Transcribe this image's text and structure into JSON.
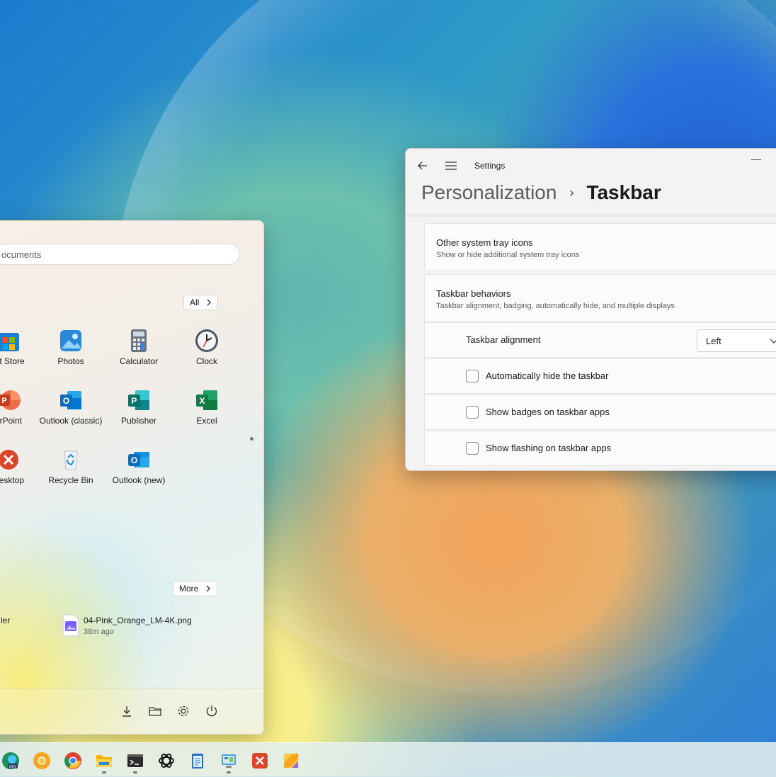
{
  "start_menu": {
    "search_placeholder": "ocuments",
    "pinned_all_label": "All",
    "pinned_apps": [
      {
        "label": "oft Store",
        "icon": "microsoft-store-icon"
      },
      {
        "label": "Photos",
        "icon": "photos-icon"
      },
      {
        "label": "Calculator",
        "icon": "calculator-icon"
      },
      {
        "label": "Clock",
        "icon": "clock-icon"
      },
      {
        "label": "erPoint",
        "icon": "powerpoint-icon"
      },
      {
        "label": "Outlook (classic)",
        "icon": "outlook-classic-icon"
      },
      {
        "label": "Publisher",
        "icon": "publisher-icon"
      },
      {
        "label": "Excel",
        "icon": "excel-icon"
      },
      {
        "label": "Desktop",
        "icon": "remote-desktop-icon"
      },
      {
        "label": "Recycle Bin",
        "icon": "recycle-bin-icon"
      },
      {
        "label": "Outlook (new)",
        "icon": "outlook-new-icon"
      }
    ],
    "recommended_more_label": "More",
    "recommended": [
      {
        "title": "ler",
        "subtitle": ""
      },
      {
        "title": "04-Pink_Orange_LM-4K.png",
        "subtitle": "38m ago"
      }
    ],
    "footer_icons": [
      "downloads-icon",
      "file-explorer-icon",
      "settings-icon",
      "power-icon"
    ]
  },
  "settings": {
    "window_title": "Settings",
    "breadcrumb_parent": "Personalization",
    "breadcrumb_separator": "›",
    "breadcrumb_current": "Taskbar",
    "other_tray": {
      "title": "Other system tray icons",
      "subtitle": "Show or hide additional system tray icons"
    },
    "behaviors": {
      "title": "Taskbar behaviors",
      "subtitle": "Taskbar alignment, badging, automatically hide, and multiple displays",
      "alignment_label": "Taskbar alignment",
      "alignment_value": "Left",
      "options": [
        {
          "label": "Automatically hide the taskbar",
          "checked": false
        },
        {
          "label": "Show badges on taskbar apps",
          "checked": false
        },
        {
          "label": "Show flashing on taskbar apps",
          "checked": false
        }
      ]
    }
  },
  "taskbar": {
    "apps": [
      "edge-dev-icon",
      "chrome-canary-icon",
      "chrome-icon",
      "file-explorer-icon",
      "terminal-icon",
      "chatgpt-icon",
      "notepad-icon",
      "control-panel-icon",
      "remote-desktop-icon",
      "sticky-notes-icon"
    ],
    "running": [
      "file-explorer-icon",
      "terminal-icon",
      "control-panel-icon"
    ]
  },
  "colors": {
    "accent": "#0067c0",
    "excel": "#107c41",
    "outlook": "#0f6cbd",
    "publisher": "#077568",
    "powerpoint": "#c43e1c"
  }
}
